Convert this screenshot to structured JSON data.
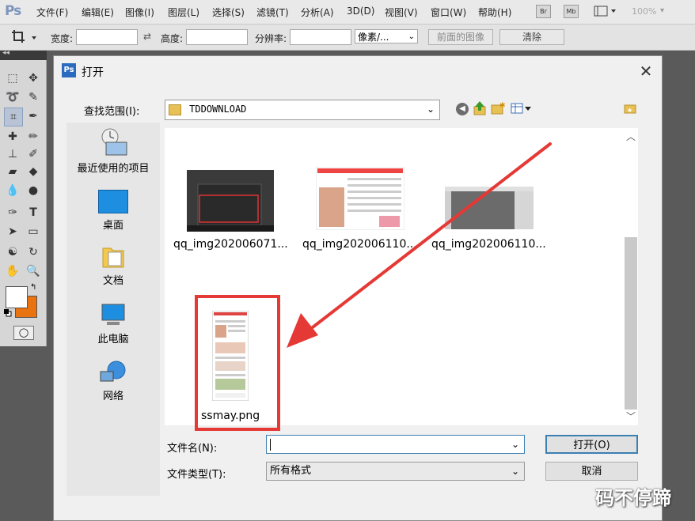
{
  "app": {
    "logo": "Ps",
    "menu": [
      "文件(F)",
      "编辑(E)",
      "图像(I)",
      "图层(L)",
      "选择(S)",
      "滤镜(T)",
      "分析(A)",
      "3D(D)",
      "视图(V)",
      "窗口(W)",
      "帮助(H)"
    ],
    "bridge_label": "Br",
    "minibridge_label": "Mb",
    "zoom": "100%"
  },
  "options": {
    "width_label": "宽度:",
    "height_label": "高度:",
    "resolution_label": "分辨率:",
    "unit_value": "像素/...",
    "front_image_label": "前面的图像",
    "clear_label": "清除"
  },
  "dialog": {
    "title": "打开",
    "lookin_label": "查找范围(I):",
    "lookin_value": "TDDOWNLOAD",
    "places": [
      "最近使用的项目",
      "桌面",
      "文档",
      "此电脑",
      "网络"
    ],
    "files": [
      {
        "name": "qq_img202006071..."
      },
      {
        "name": "qq_img202006110..."
      },
      {
        "name": "qq_img202006110..."
      },
      {
        "name": "ssmay.png"
      }
    ],
    "filename_label": "文件名(N):",
    "filename_value": "",
    "filetype_label": "文件类型(T):",
    "filetype_value": "所有格式",
    "open_button": "打开(O)",
    "cancel_button": "取消"
  },
  "watermark": "码不停蹄",
  "colors": {
    "annotation": "#e53935",
    "foreground_swatch": "#ffffff",
    "background_swatch": "#e8730f"
  }
}
